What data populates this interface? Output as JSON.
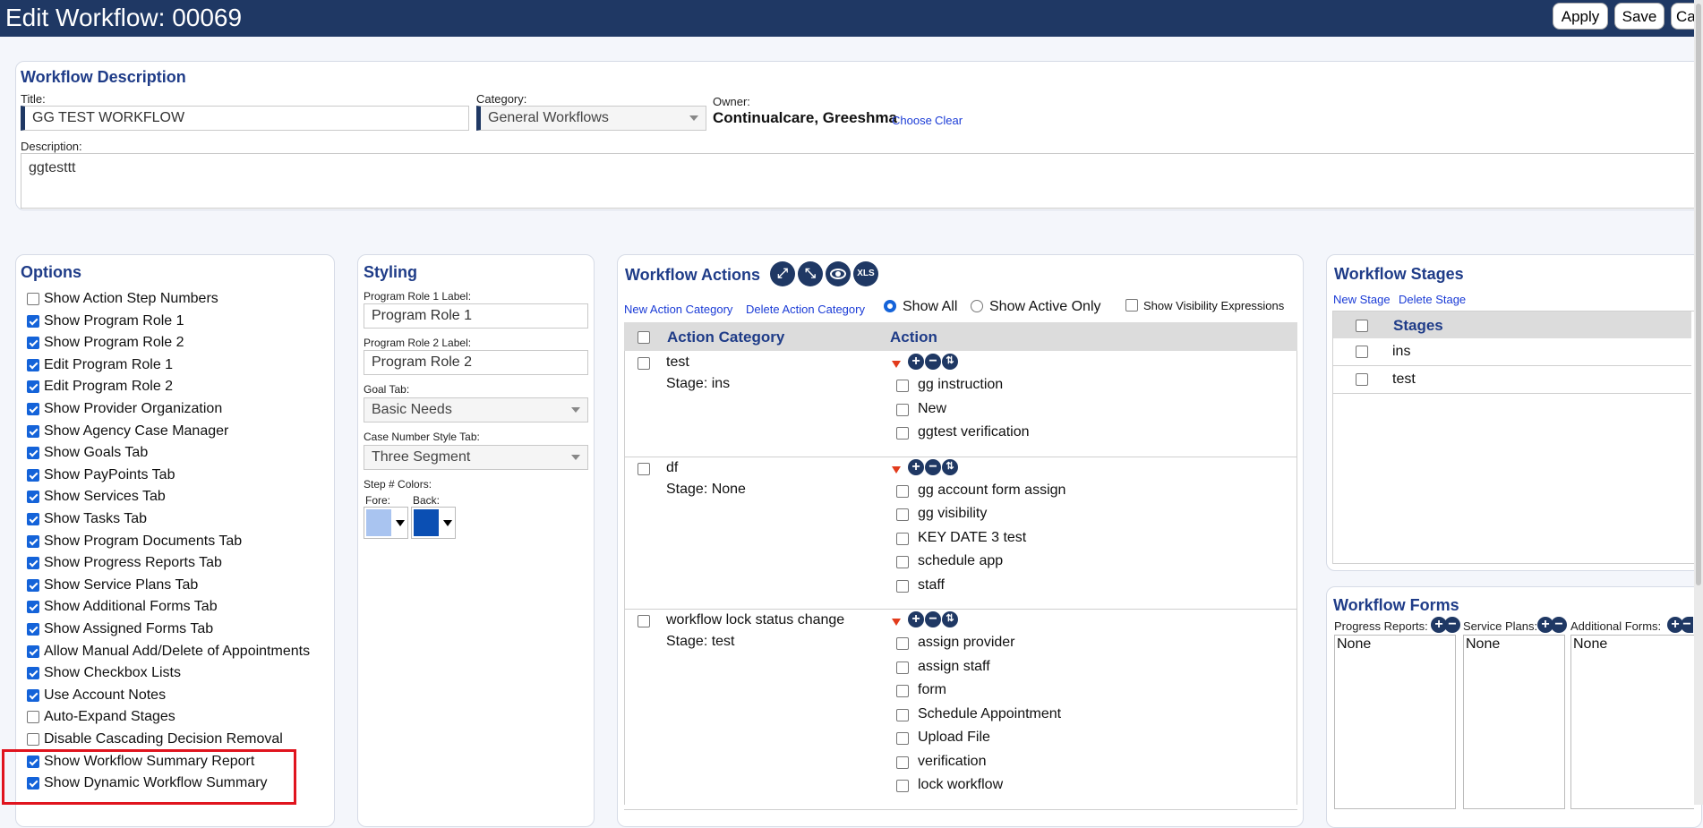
{
  "header": {
    "title": "Edit Workflow: 00069",
    "apply": "Apply",
    "save": "Save",
    "cancel": "Ca"
  },
  "description": {
    "section_title": "Workflow Description",
    "title_label": "Title:",
    "title_value": "GG TEST WORKFLOW",
    "category_label": "Category:",
    "category_value": "General Workflows",
    "owner_label": "Owner:",
    "owner_value": "Continualcare, Greeshma",
    "choose": "Choose",
    "clear": "Clear",
    "description_label": "Description:",
    "description_value": "ggtesttt"
  },
  "options": {
    "title": "Options",
    "items": [
      {
        "label": "Show Action Step Numbers",
        "checked": false
      },
      {
        "label": "Show Program Role 1",
        "checked": true
      },
      {
        "label": "Show Program Role 2",
        "checked": true
      },
      {
        "label": "Edit Program Role 1",
        "checked": true
      },
      {
        "label": "Edit Program Role 2",
        "checked": true
      },
      {
        "label": "Show Provider Organization",
        "checked": true
      },
      {
        "label": "Show Agency Case Manager",
        "checked": true
      },
      {
        "label": "Show Goals Tab",
        "checked": true
      },
      {
        "label": "Show PayPoints Tab",
        "checked": true
      },
      {
        "label": "Show Services Tab",
        "checked": true
      },
      {
        "label": "Show Tasks Tab",
        "checked": true
      },
      {
        "label": "Show Program Documents Tab",
        "checked": true
      },
      {
        "label": "Show Progress Reports Tab",
        "checked": true
      },
      {
        "label": "Show Service Plans Tab",
        "checked": true
      },
      {
        "label": "Show Additional Forms Tab",
        "checked": true
      },
      {
        "label": "Show Assigned Forms Tab",
        "checked": true
      },
      {
        "label": "Allow Manual Add/Delete of Appointments",
        "checked": true
      },
      {
        "label": "Show Checkbox Lists",
        "checked": true
      },
      {
        "label": "Use Account Notes",
        "checked": true
      },
      {
        "label": "Auto-Expand Stages",
        "checked": false
      },
      {
        "label": "Disable Cascading Decision Removal",
        "checked": false
      },
      {
        "label": "Show Workflow Summary Report",
        "checked": true
      },
      {
        "label": "Show Dynamic Workflow Summary",
        "checked": true
      }
    ]
  },
  "styling": {
    "title": "Styling",
    "role1_label": "Program Role 1 Label:",
    "role1_value": "Program Role 1",
    "role2_label": "Program Role 2 Label:",
    "role2_value": "Program Role 2",
    "goal_label": "Goal Tab:",
    "goal_value": "Basic Needs",
    "case_label": "Case Number Style Tab:",
    "case_value": "Three Segment",
    "step_colors_label": "Step # Colors:",
    "fore_label": "Fore:",
    "back_label": "Back:",
    "fore_color": "#a9c4f0",
    "back_color": "#0b4fb3"
  },
  "actions": {
    "title": "Workflow Actions",
    "xls": "XLS",
    "new_category": "New Action Category",
    "delete_category": "Delete Action Category",
    "show_all": "Show All",
    "show_active": "Show Active Only",
    "show_visibility": "Show Visibility Expressions",
    "col_category": "Action Category",
    "col_action": "Action",
    "categories": [
      {
        "name": "test",
        "stage": "Stage: ins",
        "actions": [
          "gg instruction",
          "New",
          "ggtest verification"
        ]
      },
      {
        "name": "df",
        "stage": "Stage: None",
        "actions": [
          "gg account form assign",
          "gg visibility",
          "KEY DATE 3 test",
          "schedule app",
          "staff"
        ]
      },
      {
        "name": "workflow lock status change",
        "stage": "Stage: test",
        "actions": [
          "assign provider",
          "assign staff",
          "form",
          "Schedule Appointment",
          "Upload File",
          "verification",
          "lock workflow"
        ]
      }
    ]
  },
  "stages": {
    "title": "Workflow Stages",
    "new_stage": "New Stage",
    "delete_stage": "Delete Stage",
    "col_stages": "Stages",
    "items": [
      "ins",
      "test"
    ]
  },
  "forms": {
    "title": "Workflow Forms",
    "progress_label": "Progress Reports:",
    "progress_value": "None",
    "service_label": "Service Plans:",
    "service_value": "None",
    "additional_label": "Additional Forms:",
    "additional_value": "None"
  }
}
